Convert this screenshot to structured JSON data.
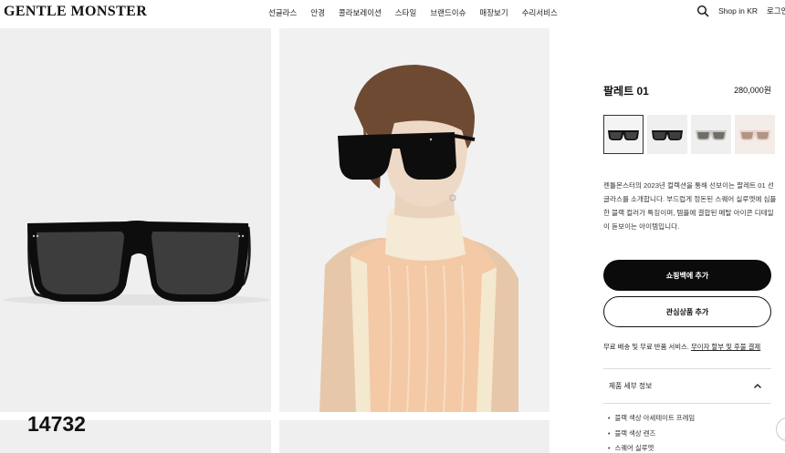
{
  "header": {
    "logo": "GENTLE MONSTER",
    "nav": [
      "선글라스",
      "안경",
      "콜라보레이션",
      "스타일",
      "브랜드이슈",
      "매장보기",
      "수리서비스"
    ],
    "shop_in": "Shop in KR",
    "login": "로그인"
  },
  "overlay_number": "14732",
  "product": {
    "name": "팔레트 01",
    "price": "280,000원",
    "swatch_icons": [
      "black-sunglasses-icon",
      "black-sunglasses-icon",
      "clear-sunglasses-icon",
      "pink-sunglasses-icon"
    ],
    "description": "젠틀몬스터의 2023년 컬렉션을 통해 선보이는 팔레트 01 선글라스를 소개합니다. 부드럽게 정돈된 스퀘어 실루엣에 심플한 블랙 컬러가 특징이며, 템플에 결합된 메탈 아이콘 디테일이 돋보이는 아이템입니다.",
    "add_to_cart": "쇼핑백에 추가",
    "add_to_wishlist": "관심상품 추가",
    "shipping_text": "무료 배송 및 무료 반품 서비스.",
    "shipping_link": "무이자 할부 및 후불 결제",
    "details_title": "제품 세부 정보",
    "details": [
      "블랙 색상 아세테이트 프레임",
      "블랙 색상 렌즈",
      "스퀘어 실루엣"
    ]
  },
  "colors": {
    "frame": "#0d0d0d",
    "lens": "#3c3d3c",
    "panel_bg": "#efefef",
    "button_dark": "#0b0b0b"
  }
}
